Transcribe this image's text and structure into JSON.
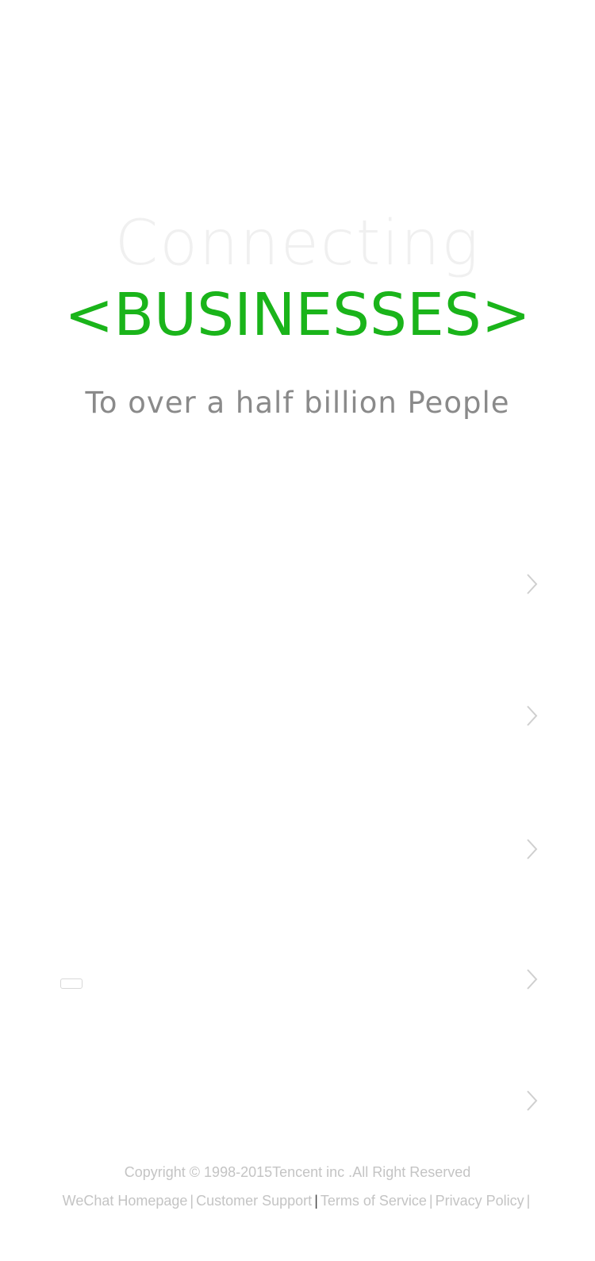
{
  "hero": {
    "title": "Connecting",
    "highlight": "<BUSINESSES>",
    "subtitle": "To over a half billion People"
  },
  "colors": {
    "accent": "#1ab41a",
    "title": "#f0f0f0",
    "subtitle": "#8a8a8a",
    "footer": "#c4c4c4"
  },
  "rows": [
    {
      "icon": "chevron-right-icon"
    },
    {
      "icon": "chevron-right-icon"
    },
    {
      "icon": "chevron-right-icon"
    },
    {
      "icon": "chevron-right-icon"
    },
    {
      "icon": "chevron-right-icon"
    }
  ],
  "footer": {
    "copyright": "Copyright © 1998-2015Tencent inc .All Right Reserved",
    "links": {
      "homepage": "WeChat Homepage",
      "support": "Customer Support",
      "terms": "Terms of Service",
      "privacy": "Privacy Policy"
    },
    "separator": "|"
  }
}
